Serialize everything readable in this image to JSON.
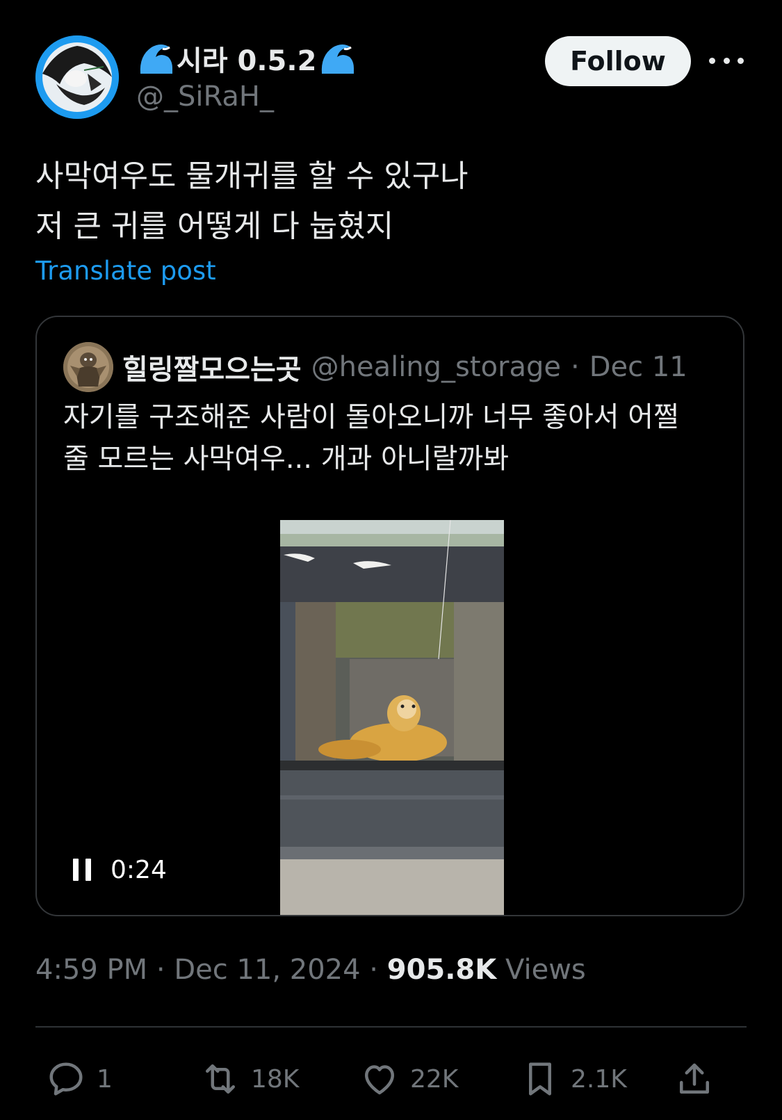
{
  "author": {
    "display_name": "시라 0.5.2",
    "handle": "@_SiRaH_",
    "follow_label": "Follow"
  },
  "post": {
    "line1": "사막여우도 물개귀를 할 수 있구나",
    "line2": "저 큰 귀를 어떻게 다 눕혔지",
    "translate_label": "Translate post"
  },
  "quoted": {
    "display_name": "힐링짤모으는곳",
    "handle": "@healing_storage",
    "separator": "·",
    "date": "Dec 11",
    "line1": "자기를 구조해준 사람이 돌아오니까 너무 좋아서 어쩔",
    "line2": "줄 모르는 사막여우... 개과 아니랄까봐",
    "video_time": "0:24"
  },
  "meta": {
    "time": "4:59 PM",
    "sep1": "·",
    "date": "Dec 11, 2024",
    "sep2": "·",
    "views_count": "905.8K",
    "views_label": "Views"
  },
  "actions": {
    "replies": "1",
    "reposts": "18K",
    "likes": "22K",
    "bookmarks": "2.1K"
  },
  "colors": {
    "background": "#000000",
    "link": "#1d9bf0",
    "muted": "#71767b",
    "text": "#e7e9ea",
    "wave_emoji": "#3fa9f5"
  },
  "icons": [
    "avatar",
    "wave-icon",
    "more-icon",
    "pause-icon",
    "reply-icon",
    "repost-icon",
    "like-icon",
    "bookmark-icon",
    "share-icon"
  ]
}
